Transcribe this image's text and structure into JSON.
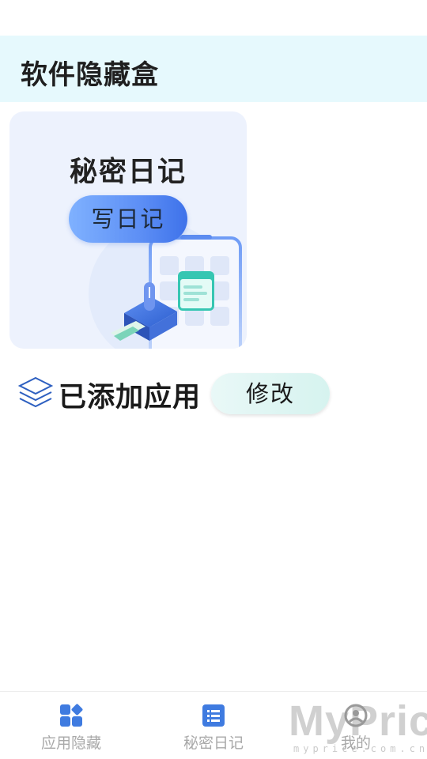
{
  "header": {
    "title": "软件隐藏盒"
  },
  "diary_card": {
    "title": "秘密日记",
    "button_label": "写日记",
    "illustration_icon": "phone-security-illustration"
  },
  "apps_section": {
    "icon": "layers-icon",
    "title": "已添加应用",
    "modify_label": "修改"
  },
  "bottom_nav": {
    "items": [
      {
        "label": "应用隐藏",
        "icon": "apps-grid-icon",
        "active": true
      },
      {
        "label": "秘密日记",
        "icon": "list-document-icon",
        "active": false
      },
      {
        "label": "我的",
        "icon": "profile-icon",
        "active": false
      }
    ]
  },
  "watermark": {
    "main": "MyPrice",
    "sub": "myprice.com.cn"
  },
  "colors": {
    "header_bg": "#e6f9fd",
    "card_bg": "#edf2fd",
    "accent_blue": "#3f7be0",
    "button_gradient_start": "#7fb1ff",
    "button_gradient_end": "#3e72ea",
    "modify_bg": "#d6f3ef",
    "nav_label": "#a9a9a9"
  }
}
